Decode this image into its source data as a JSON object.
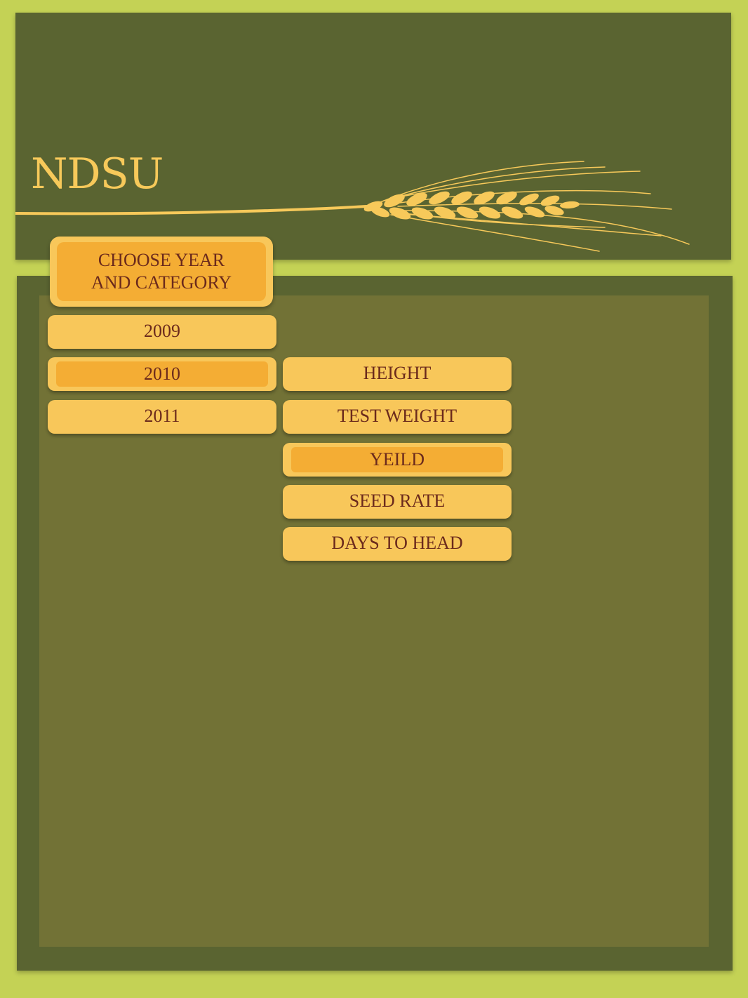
{
  "header": {
    "logo_text": "NDSU"
  },
  "chooser": {
    "line1": "CHOOSE YEAR",
    "line2": "AND CATEGORY"
  },
  "years": [
    {
      "label": "2009",
      "selected": false
    },
    {
      "label": "2010",
      "selected": true
    },
    {
      "label": "2011",
      "selected": false
    }
  ],
  "categories": [
    {
      "label": "HEIGHT",
      "selected": false
    },
    {
      "label": "TEST WEIGHT",
      "selected": false
    },
    {
      "label": "YEILD",
      "selected": true
    },
    {
      "label": "SEED RATE",
      "selected": false
    },
    {
      "label": "DAYS TO HEAD",
      "selected": false
    }
  ],
  "colors": {
    "page_bg": "#c4d255",
    "panel_dark": "#5a6431",
    "panel_inner": "#727236",
    "button": "#f8c75a",
    "button_selected": "#f4ad34",
    "button_text": "#6b2a1c",
    "logo": "#f7c95a"
  },
  "icons": {
    "wheat": "wheat-stalk-icon"
  }
}
